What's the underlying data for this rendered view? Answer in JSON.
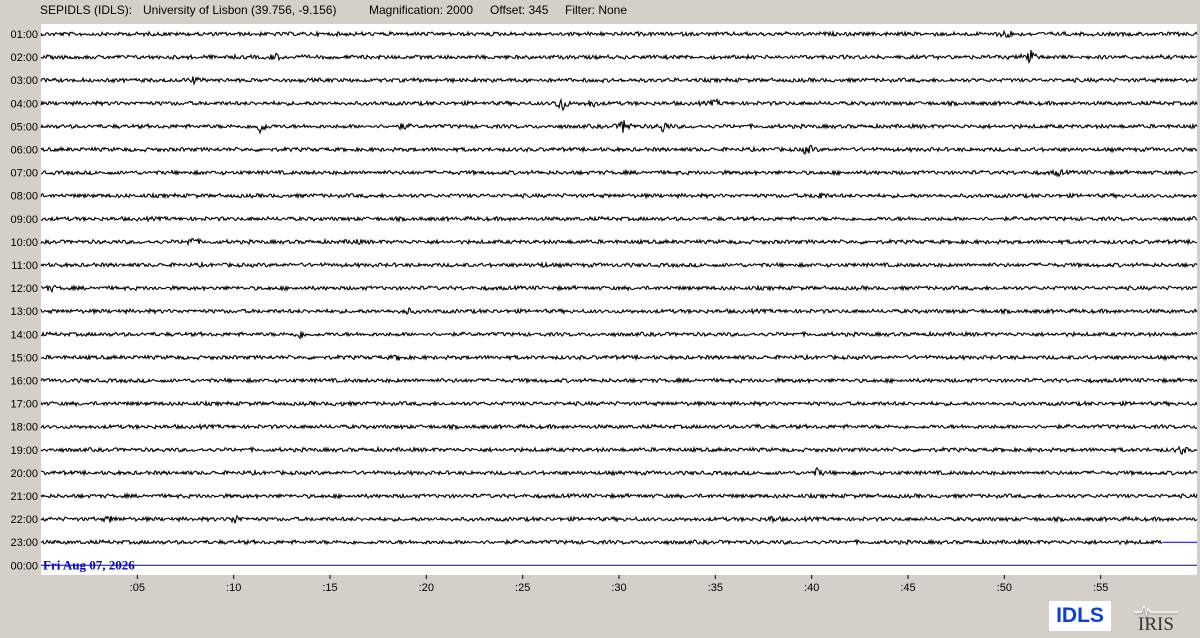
{
  "header": {
    "station": "SEPIDLS (IDLS):",
    "location": "University of Lisbon (39.756, -9.156)",
    "magnification": "Magnification: 2000",
    "offset": "Offset: 345",
    "filter": "Filter: None"
  },
  "logos": {
    "idls": "IDLS",
    "iris": "IRIS"
  },
  "colors": {
    "background": "#d4d0c8",
    "plot_area": "#ffffff",
    "trace": "#000000",
    "current_line": "#0000cc",
    "date_text": "#0000cc"
  },
  "chart_data": {
    "type": "line",
    "title": "",
    "xlabel": "",
    "ylabel": "",
    "date_label": "Fri Aug 07, 2026",
    "x_unit": "minutes",
    "xlim": [
      0,
      60
    ],
    "x_ticks": [
      {
        "value": 5,
        "label": ":05"
      },
      {
        "value": 10,
        "label": ":10"
      },
      {
        "value": 15,
        "label": ":15"
      },
      {
        "value": 20,
        "label": ":20"
      },
      {
        "value": 25,
        "label": ":25"
      },
      {
        "value": 30,
        "label": ":30"
      },
      {
        "value": 35,
        "label": ":35"
      },
      {
        "value": 40,
        "label": ":40"
      },
      {
        "value": 45,
        "label": ":45"
      },
      {
        "value": 50,
        "label": ":50"
      },
      {
        "value": 55,
        "label": ":55"
      }
    ],
    "rows": [
      {
        "label": "01:00",
        "events": [
          {
            "minute": 50.1,
            "amp": 6
          }
        ]
      },
      {
        "label": "02:00",
        "events": [
          {
            "minute": 12.1,
            "amp": 4
          },
          {
            "minute": 51.3,
            "amp": 12
          }
        ]
      },
      {
        "label": "03:00",
        "events": [
          {
            "minute": 7.9,
            "amp": 3
          }
        ]
      },
      {
        "label": "04:00",
        "events": [
          {
            "minute": 27.0,
            "amp": 10
          },
          {
            "minute": 28.6,
            "amp": 4
          },
          {
            "minute": 35.0,
            "amp": 3
          }
        ]
      },
      {
        "label": "05:00",
        "events": [
          {
            "minute": 11.4,
            "amp": 7
          },
          {
            "minute": 18.8,
            "amp": 3
          },
          {
            "minute": 30.3,
            "amp": 10
          },
          {
            "minute": 32.3,
            "amp": 6
          }
        ]
      },
      {
        "label": "06:00",
        "events": [
          {
            "minute": 39.8,
            "amp": 6
          }
        ]
      },
      {
        "label": "07:00",
        "events": [
          {
            "minute": 52.8,
            "amp": 3
          }
        ]
      },
      {
        "label": "08:00",
        "events": [
          {
            "minute": 40.4,
            "amp": 4
          }
        ]
      },
      {
        "label": "09:00",
        "events": []
      },
      {
        "label": "10:00",
        "events": [
          {
            "minute": 7.8,
            "amp": 5
          },
          {
            "minute": 16.3,
            "amp": 3
          }
        ]
      },
      {
        "label": "11:00",
        "events": [
          {
            "minute": 26.0,
            "amp": 2
          }
        ]
      },
      {
        "label": "12:00",
        "events": [
          {
            "minute": 0.5,
            "amp": 3
          }
        ]
      },
      {
        "label": "13:00",
        "events": [
          {
            "minute": 19.0,
            "amp": 3
          }
        ]
      },
      {
        "label": "14:00",
        "events": [
          {
            "minute": 13.5,
            "amp": 4
          }
        ]
      },
      {
        "label": "15:00",
        "events": [
          {
            "minute": 18.6,
            "amp": 3
          }
        ]
      },
      {
        "label": "16:00",
        "events": []
      },
      {
        "label": "17:00",
        "events": [
          {
            "minute": 15.5,
            "amp": 2
          }
        ]
      },
      {
        "label": "18:00",
        "events": [
          {
            "minute": 37.0,
            "amp": 2
          }
        ]
      },
      {
        "label": "19:00",
        "events": [
          {
            "minute": 59.2,
            "amp": 4
          }
        ]
      },
      {
        "label": "20:00",
        "events": [
          {
            "minute": 40.3,
            "amp": 4
          }
        ]
      },
      {
        "label": "21:00",
        "events": []
      },
      {
        "label": "22:00",
        "events": [
          {
            "minute": 3.6,
            "amp": 3
          },
          {
            "minute": 10.1,
            "amp": 5
          },
          {
            "minute": 38.0,
            "amp": 3
          }
        ]
      },
      {
        "label": "23:00",
        "events": [],
        "trace_end_minute": 58.2
      },
      {
        "label": "00:00",
        "events": [],
        "trace_end_minute": 0
      }
    ],
    "grid": false,
    "legend": "none"
  }
}
